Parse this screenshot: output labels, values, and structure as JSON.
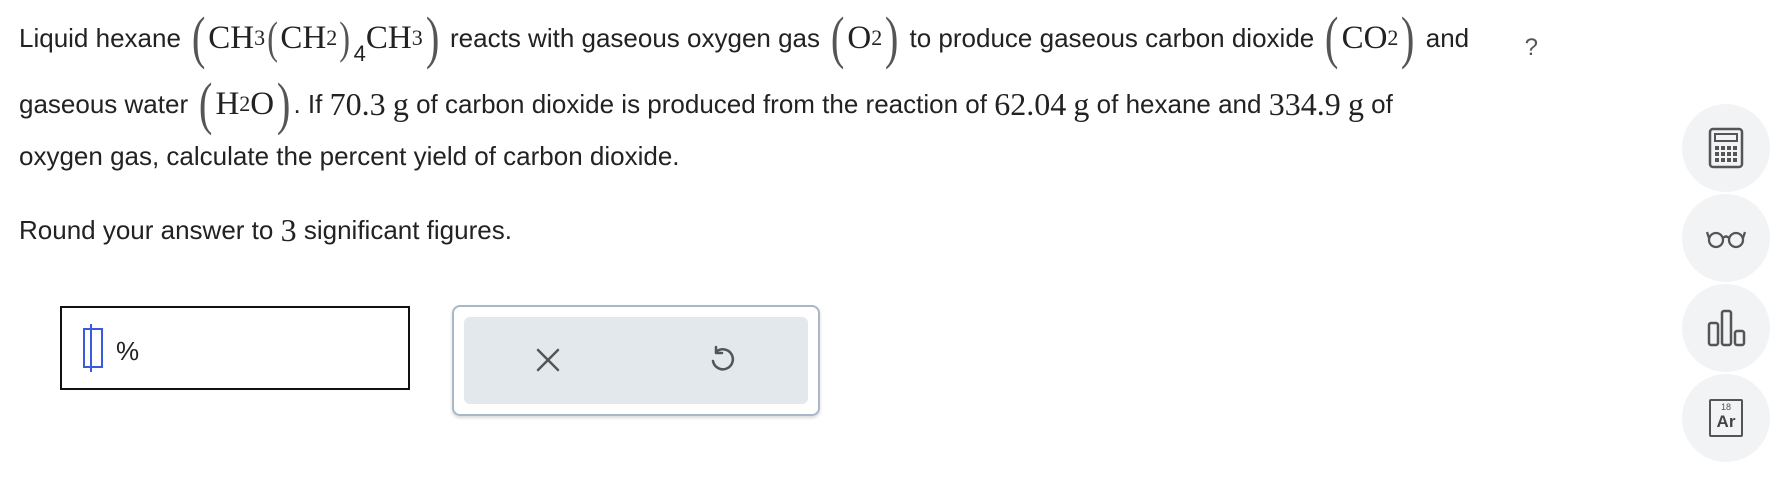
{
  "problem": {
    "p1": "Liquid hexane",
    "hexane_ch3": "CH",
    "hexane_sub3": "3",
    "hexane_ch2": "CH",
    "hexane_sub2": "2",
    "hexane_sub4": "4",
    "hexane_ch3b": "CH",
    "hexane_sub3b": "3",
    "p2": "reacts with gaseous oxygen gas",
    "o2_o": "O",
    "o2_sub": "2",
    "p3": "to produce gaseous carbon dioxide",
    "co2_co": "CO",
    "co2_sub": "2",
    "p4": "and",
    "p5": "gaseous water",
    "h2o_h": "H",
    "h2o_sub": "2",
    "h2o_o": "O",
    "p6": ". If",
    "v1": "70.3",
    "u1": "g",
    "p7": "of carbon dioxide is produced from the reaction of",
    "v2": "62.04",
    "u2": "g",
    "p8": "of hexane and",
    "v3": "334.9",
    "u3": "g",
    "p9": "of",
    "line3": "oxygen gas, calculate the percent yield of carbon dioxide.",
    "round_a": "Round your answer to",
    "round_n": "3",
    "round_b": "significant figures."
  },
  "help_label": "?",
  "answer": {
    "value": "",
    "unit": "%"
  },
  "buttons": {
    "clear_icon": "x-icon",
    "undo_icon": "undo-icon"
  },
  "sidebar": {
    "calculator_icon": "calculator-icon",
    "glasses_icon": "glasses-icon",
    "chart_icon": "bar-chart-icon",
    "periodic_number": "18",
    "periodic_symbol": "Ar"
  }
}
